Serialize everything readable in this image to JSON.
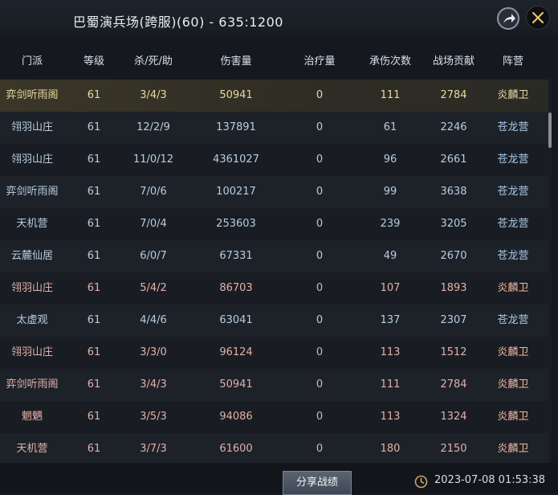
{
  "title": "巴蜀演兵场(跨服)(60) - 635:1200",
  "icons": {
    "share": "share-arrow-icon",
    "close": "close-icon",
    "clock": "clock-icon"
  },
  "columns": [
    "门派",
    "等级",
    "杀/死/助",
    "伤害量",
    "治疗量",
    "承伤次数",
    "战场贡献",
    "阵营"
  ],
  "rows": [
    {
      "sect": "弈剑听雨阁",
      "level": "61",
      "kda": "3/4/3",
      "damage": "50941",
      "heal": "0",
      "hits": "111",
      "contrib": "2784",
      "faction": "炎麟卫"
    },
    {
      "sect": "翎羽山庄",
      "level": "61",
      "kda": "12/2/9",
      "damage": "137891",
      "heal": "0",
      "hits": "61",
      "contrib": "2246",
      "faction": "苍龙营"
    },
    {
      "sect": "翎羽山庄",
      "level": "61",
      "kda": "11/0/12",
      "damage": "4361027",
      "heal": "0",
      "hits": "96",
      "contrib": "2661",
      "faction": "苍龙营"
    },
    {
      "sect": "弈剑听雨阁",
      "level": "61",
      "kda": "7/0/6",
      "damage": "100217",
      "heal": "0",
      "hits": "99",
      "contrib": "3638",
      "faction": "苍龙营"
    },
    {
      "sect": "天机营",
      "level": "61",
      "kda": "7/0/4",
      "damage": "253603",
      "heal": "0",
      "hits": "239",
      "contrib": "3205",
      "faction": "苍龙营"
    },
    {
      "sect": "云麓仙居",
      "level": "61",
      "kda": "6/0/7",
      "damage": "67331",
      "heal": "0",
      "hits": "49",
      "contrib": "2670",
      "faction": "苍龙营"
    },
    {
      "sect": "翎羽山庄",
      "level": "61",
      "kda": "5/4/2",
      "damage": "86703",
      "heal": "0",
      "hits": "107",
      "contrib": "1893",
      "faction": "炎麟卫"
    },
    {
      "sect": "太虚观",
      "level": "61",
      "kda": "4/4/6",
      "damage": "63041",
      "heal": "0",
      "hits": "137",
      "contrib": "2307",
      "faction": "苍龙营"
    },
    {
      "sect": "翎羽山庄",
      "level": "61",
      "kda": "3/3/0",
      "damage": "96124",
      "heal": "0",
      "hits": "113",
      "contrib": "1512",
      "faction": "炎麟卫"
    },
    {
      "sect": "弈剑听雨阁",
      "level": "61",
      "kda": "3/4/3",
      "damage": "50941",
      "heal": "0",
      "hits": "111",
      "contrib": "2784",
      "faction": "炎麟卫"
    },
    {
      "sect": "魍魉",
      "level": "61",
      "kda": "3/5/3",
      "damage": "94086",
      "heal": "0",
      "hits": "113",
      "contrib": "1324",
      "faction": "炎麟卫"
    },
    {
      "sect": "天机营",
      "level": "61",
      "kda": "3/7/3",
      "damage": "61600",
      "heal": "0",
      "hits": "180",
      "contrib": "2150",
      "faction": "炎麟卫"
    }
  ],
  "share_button": "分享战绩",
  "timestamp": "2023-07-08 01:53:38",
  "colors": {
    "highlight_text": "#e8d9a0",
    "yan_faction": "#f0b8a0",
    "cang_faction": "#a9c7e6"
  }
}
